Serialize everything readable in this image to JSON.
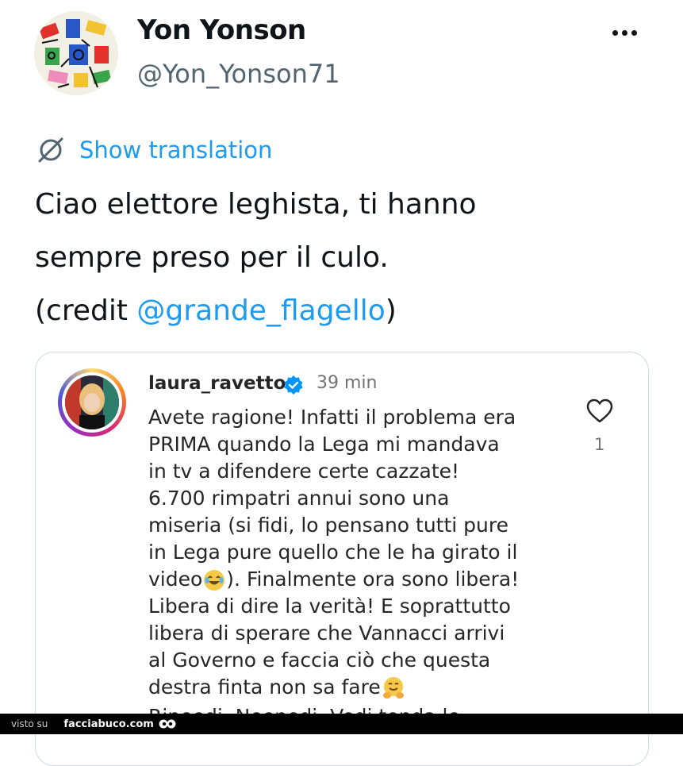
{
  "author": {
    "name": "Yon Yonson",
    "handle": "@Yon_Yonson71"
  },
  "translate": {
    "label": "Show translation"
  },
  "tweet": {
    "line1": "Ciao elettore leghista, ti hanno",
    "line2": "sempre preso per il culo.",
    "line3_prefix": "(credit ",
    "mention": "@grande_flagello",
    "line3_suffix": ")"
  },
  "embedded_comment": {
    "username": "laura_ravetto",
    "time": "39 min",
    "likes": "1",
    "lines": [
      "Avete ragione! Infatti il problema era",
      "PRIMA quando la Lega mi mandava",
      "in tv a difendere certe cazzate!",
      "6.700 rimpatri annui sono una",
      "miseria (si fidi, lo pensano tutti pure",
      "in Lega pure quello che le ha girato il",
      "video",
      "). Finalmente ora sono libera!",
      "Libera di dire la verità! E soprattutto",
      "libera di sperare che Vannacci arrivi",
      "al Governo e faccia ciò che questa",
      "destra finta non sa fare"
    ],
    "cut_line": "Ripeedi, Neepedi, Vedi tenda le"
  },
  "footer": {
    "visto_su": "visto su",
    "brand": "facciabuco.com"
  },
  "colors": {
    "link": "#1d9bf0",
    "secondary": "#536471",
    "ig_text": "#262626",
    "ig_muted": "#737373",
    "verified": "#0095f6"
  }
}
